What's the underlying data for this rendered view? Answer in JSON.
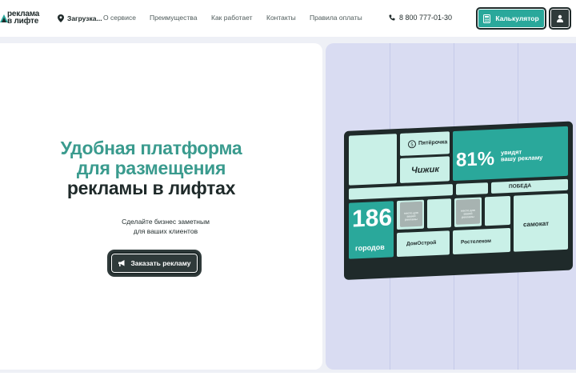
{
  "header": {
    "logo_text_line1": "реклама",
    "logo_text_line2": "в лифте",
    "location": "Загрузка...",
    "nav": [
      "О сервисе",
      "Преимущества",
      "Как работает",
      "Контакты",
      "Правила оплаты"
    ],
    "phone": "8 800 777-01-30",
    "calc_label": "Калькулятор"
  },
  "hero": {
    "title_line1": "Удобная платформа",
    "title_line2": "для размещения",
    "title_line3": "рекламы в лифтах",
    "subtitle_line1": "Сделайте бизнес заметным",
    "subtitle_line2": "для ваших клиентов",
    "order_label": "Заказать рекламу"
  },
  "screen": {
    "brand_pyaterochka": "Пятёрочка",
    "brand_chizhik": "Чижик",
    "percent": "81%",
    "percent_caption_line1": "увидят",
    "percent_caption_line2": "вашу рекламу",
    "brand_pobeda": "ПОБЕДА",
    "cities_num": "186",
    "cities_label": "городов",
    "brand_domostroy": "ДомОстрой",
    "brand_rostelecom": "Ростелеком",
    "brand_samokat": "самокат",
    "grey_note_1": "место для вашей рекламы",
    "grey_note_2": "место для вашей рекламы"
  },
  "colors": {
    "accent": "#2aa89b",
    "dark": "#2f3a3a",
    "tile": "#c9f0e7",
    "panel": "#d9dcf2"
  }
}
